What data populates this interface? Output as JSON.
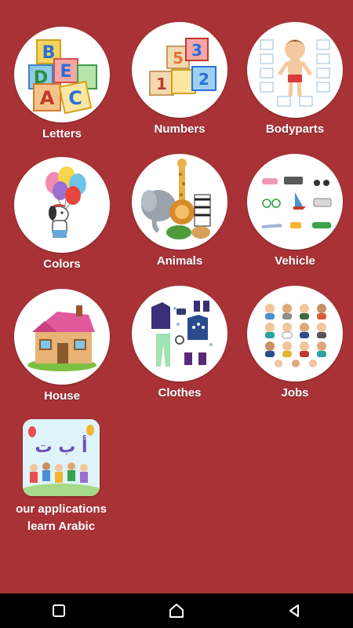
{
  "colors": {
    "background": "#a83236",
    "tile": "#ffffff",
    "navbar": "#000000"
  },
  "categories": [
    {
      "label": "Letters",
      "icon": "letter-blocks-icon"
    },
    {
      "label": "Numbers",
      "icon": "number-blocks-icon"
    },
    {
      "label": "Bodyparts",
      "icon": "body-parts-icon"
    },
    {
      "label": "Colors",
      "icon": "balloons-dog-icon"
    },
    {
      "label": "Animals",
      "icon": "animals-icon"
    },
    {
      "label": "Vehicle",
      "icon": "vehicles-icon"
    },
    {
      "label": "House",
      "icon": "house-icon"
    },
    {
      "label": "Clothes",
      "icon": "clothes-icon"
    },
    {
      "label": "Jobs",
      "icon": "jobs-icon"
    }
  ],
  "apps": {
    "label_line1": "our applications",
    "label_line2": "learn Arabic",
    "icon_text": "أ ب ت"
  },
  "navbar": {
    "recents": "square-icon",
    "home": "circle-icon",
    "back": "triangle-icon"
  }
}
